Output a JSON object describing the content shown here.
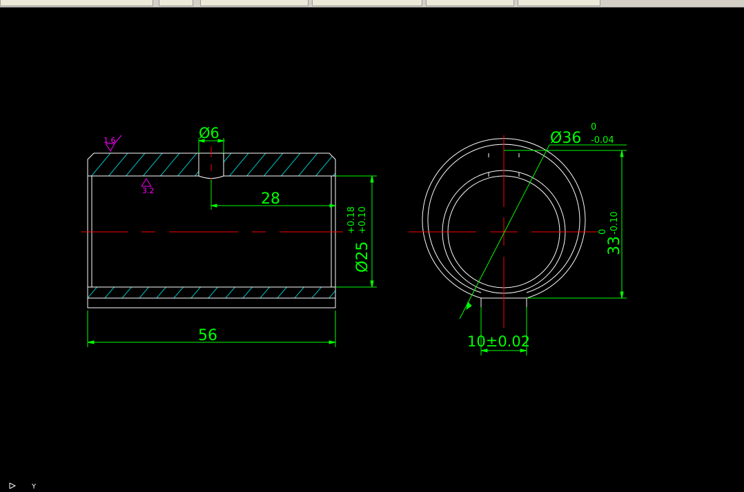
{
  "toolbar": {
    "tabs": [
      "",
      "",
      "",
      "",
      "",
      ""
    ]
  },
  "colors": {
    "background": "#000000",
    "outline": "#ffffff",
    "hatch": "#00c8c8",
    "dimension": "#00ff00",
    "centerline": "#ff0000",
    "roughness": "#ff00ff"
  },
  "drawing": {
    "front_view": {
      "hole_dim": "Ø6",
      "offset_dim": "28",
      "length_dim": "56",
      "bore_dim": "Ø25",
      "bore_tol_upper": "+0.18",
      "bore_tol_lower": "+0.10",
      "roughness_outer": "1.6",
      "roughness_inner": "3.2"
    },
    "side_view": {
      "outer_dim": "Ø36",
      "outer_tol_upper": "0",
      "outer_tol_lower": "-0.04",
      "height_dim": "33",
      "height_tol_upper": "0",
      "height_tol_lower": "-0.10",
      "slot_dim": "10±0.02"
    }
  },
  "ucs": {
    "label": "Y"
  }
}
